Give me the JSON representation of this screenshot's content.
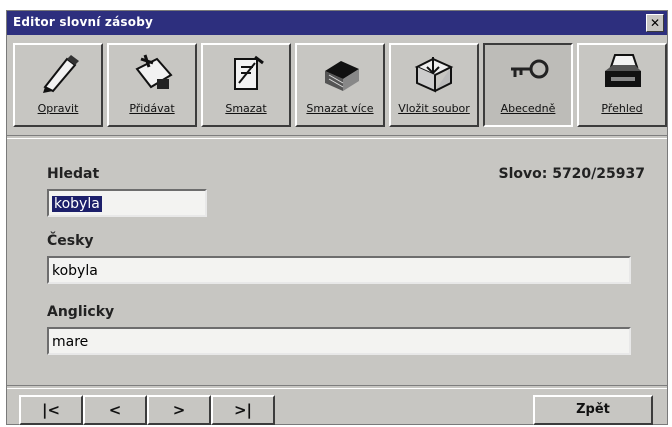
{
  "window": {
    "title": "Editor slovní zásoby",
    "close_glyph": "✕"
  },
  "toolbar": {
    "buttons": [
      {
        "id": "opravit",
        "label": "Opravit",
        "icon": "pen-icon"
      },
      {
        "id": "pridavat",
        "label": "Přidávat",
        "icon": "add-card-icon"
      },
      {
        "id": "smazat",
        "label": "Smazat",
        "icon": "delete-card-icon"
      },
      {
        "id": "smazat-vice",
        "label": "Smazat více",
        "icon": "delete-stack-icon"
      },
      {
        "id": "vlozit-soubor",
        "label": "Vložit soubor",
        "icon": "insert-file-icon"
      },
      {
        "id": "abecedne",
        "label": "Abecedně",
        "icon": "key-icon"
      },
      {
        "id": "prehled",
        "label": "Přehled",
        "icon": "printer-icon"
      }
    ]
  },
  "form": {
    "search_label": "Hledat",
    "search_value": "kobyla",
    "czech_label": "Česky",
    "czech_value": "kobyla",
    "english_label": "Anglicky",
    "english_value": "mare",
    "counter": "Slovo: 5720/25937"
  },
  "nav": {
    "first": "|<",
    "prev": "<",
    "next": ">",
    "last": ">|"
  },
  "back_button": "Zpět"
}
